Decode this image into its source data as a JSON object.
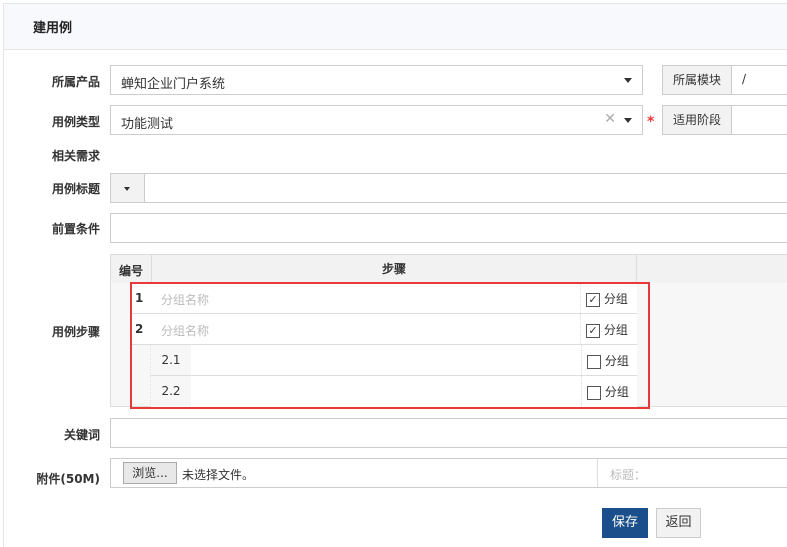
{
  "header": {
    "title": "建用例"
  },
  "form": {
    "product": {
      "label": "所属产品",
      "value": "蝉知企业门户系统"
    },
    "module": {
      "label": "所属模块",
      "value": "/"
    },
    "type": {
      "label": "用例类型",
      "value": "功能测试",
      "required": "*"
    },
    "stage": {
      "label": "适用阶段",
      "value": ""
    },
    "story": {
      "label": "相关需求"
    },
    "case_title": {
      "label": "用例标题",
      "value": ""
    },
    "precondition": {
      "label": "前置条件",
      "value": ""
    },
    "steps": {
      "label": "用例步骤",
      "headers": [
        "编号",
        "步骤"
      ],
      "rows": [
        {
          "num": "1",
          "placeholder": "分组名称",
          "group_label": "分组",
          "checked": true
        },
        {
          "num": "2",
          "placeholder": "分组名称",
          "group_label": "分组",
          "checked": true
        },
        {
          "num": "",
          "sub": "2.1",
          "group_label": "分组",
          "checked": false
        },
        {
          "num": "",
          "sub": "2.2",
          "group_label": "分组",
          "checked": false
        }
      ]
    },
    "keywords": {
      "label": "关键词",
      "value": ""
    },
    "attachment": {
      "label": "附件(50M)",
      "browse": "浏览...",
      "no_file": "未选择文件。",
      "title_placeholder": "标题："
    }
  },
  "actions": {
    "save": "保存",
    "back": "返回"
  },
  "colors": {
    "primary": "#1a4f8b",
    "highlight": "#e8393a",
    "required": "#e8393a"
  }
}
